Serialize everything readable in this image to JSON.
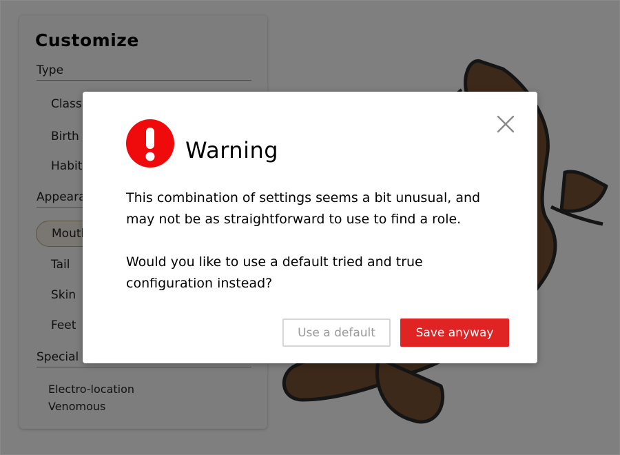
{
  "sidebar": {
    "title": "Customize",
    "type_section": "Type",
    "type_items": [
      "Class",
      "Birth",
      "Habitat"
    ],
    "appearance_section": "Appearance",
    "appearance_items": [
      "Mouth",
      "Tail",
      "Skin",
      "Feet"
    ],
    "special_section": "Special",
    "special_items": [
      "Electro-location",
      "Venomous"
    ]
  },
  "dialog": {
    "title": "Warning",
    "body_paragraph_1": "This combination of settings seems a bit unusual, and may not be as straightforward to use to find a role.",
    "body_paragraph_2": "Would you like to use a default tried and true configuration instead?",
    "default_button_label": "Use a default",
    "save_button_label": "Save anyway",
    "close_icon": "close-icon",
    "alert_icon": "exclamation-circle-icon"
  },
  "colors": {
    "alert_red": "#e02323",
    "creature_brown": "#7a5232",
    "overlay": "rgba(0,0,0,0.5)"
  }
}
